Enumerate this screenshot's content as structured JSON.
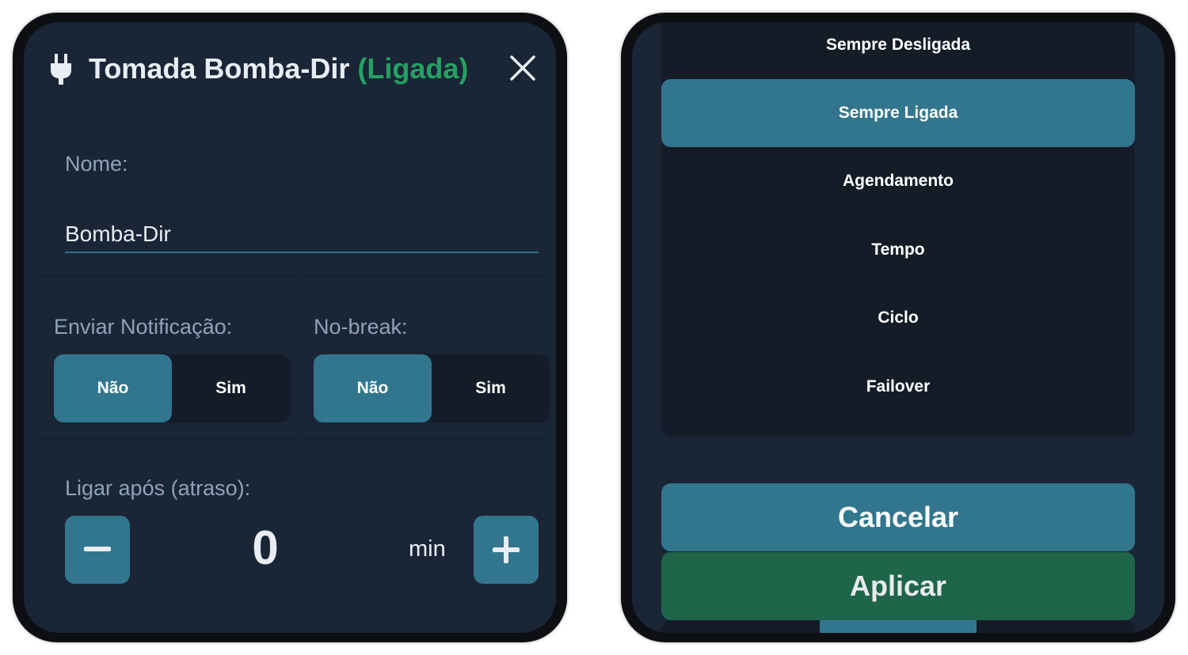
{
  "left_panel": {
    "title": "Tomada Bomba-Dir",
    "state_label": "(Ligada)",
    "colors": {
      "state": "#26a062",
      "accent": "#32768e"
    },
    "icons": {
      "device": "plug-icon",
      "close": "close-icon"
    },
    "name_label": "Nome:",
    "name_value": "Bomba-Dir",
    "notification": {
      "label": "Enviar Notificação:",
      "options": [
        "Não",
        "Sim"
      ],
      "selected": "Não"
    },
    "nobreak": {
      "label": "No-break:",
      "options": [
        "Não",
        "Sim"
      ],
      "selected": "Não"
    },
    "delay": {
      "label": "Ligar após (atraso):",
      "value": "0",
      "unit": "min",
      "icons": {
        "decrement": "minus-icon",
        "increment": "plus-icon"
      }
    }
  },
  "right_panel": {
    "modes": [
      "Sempre Desligada",
      "Sempre Ligada",
      "Agendamento",
      "Tempo",
      "Ciclo",
      "Failover"
    ],
    "selected_mode": "Sempre Ligada",
    "cancel_label": "Cancelar",
    "apply_label": "Aplicar",
    "colors": {
      "cancel": "#32768e",
      "apply": "#1e654a"
    }
  }
}
